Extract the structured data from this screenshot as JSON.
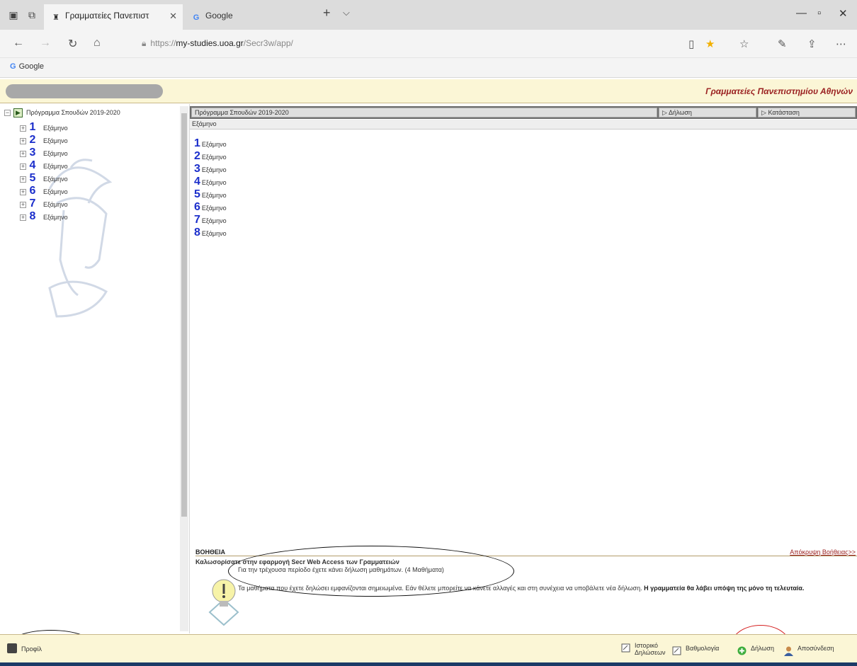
{
  "browser": {
    "tabs": [
      {
        "title": "Γραμματείες Πανεπιστ",
        "active": true
      },
      {
        "title": "Google",
        "active": false
      }
    ],
    "url": {
      "prefix": "https://",
      "host": "my-studies.uoa.gr",
      "path": "/Secr3w/app/"
    },
    "favorites": [
      {
        "label": "Google"
      }
    ]
  },
  "app": {
    "title": "Γραμματείες Πανεπιστημίου Αθηνών",
    "accent": "#9b2222",
    "header_bg": "#fbf6d6"
  },
  "tree": {
    "root_label": "Πρόγραμμα Σπουδών 2019-2020",
    "semester_word": "Εξάμηνο",
    "semesters": [
      "1",
      "2",
      "3",
      "4",
      "5",
      "6",
      "7",
      "8"
    ]
  },
  "grid": {
    "columns": [
      "Πρόγραμμα Σπουδών 2019-2020",
      "Δήλωση",
      "Κατάσταση"
    ],
    "sub_header": "Εξάμηνο",
    "semester_word": "Εξάμηνο",
    "rows": [
      "1",
      "2",
      "3",
      "4",
      "5",
      "6",
      "7",
      "8"
    ]
  },
  "help": {
    "title": "ΒΟΗΘΕΙΑ",
    "hide_link": "Απόκρυψη Βοήθειας>>",
    "welcome": "Καλωσορίσατε στην εφαρμογή Secr Web Access των Γραμματειών",
    "period_text": "Για την τρέχουσα περίοδο έχετε κάνει δήλωση μαθημάτων. (4 Μαθήματα)",
    "note_text": "Τα μαθήματα που έχετε δηλώσει εμφανίζονται σημειωμένα. Εάν θέλετε μπορείτε να κάνετε αλλαγές και στη συνέχεια να υποβάλετε νέα δήλωση.",
    "note_bold": "Η γραμματεία θα λάβει υπόψη της μόνο τη τελευταία."
  },
  "footer": {
    "home_label": "Προφίλ",
    "buttons": [
      {
        "label_line1": "Ιστορικό",
        "label_line2": "Δηλώσεων"
      },
      {
        "label_line1": "Βαθμολογία",
        "label_line2": ""
      },
      {
        "label_line1": "Δήλωση",
        "label_line2": ""
      },
      {
        "label_line1": "Αποσύνδεση",
        "label_line2": ""
      }
    ]
  }
}
